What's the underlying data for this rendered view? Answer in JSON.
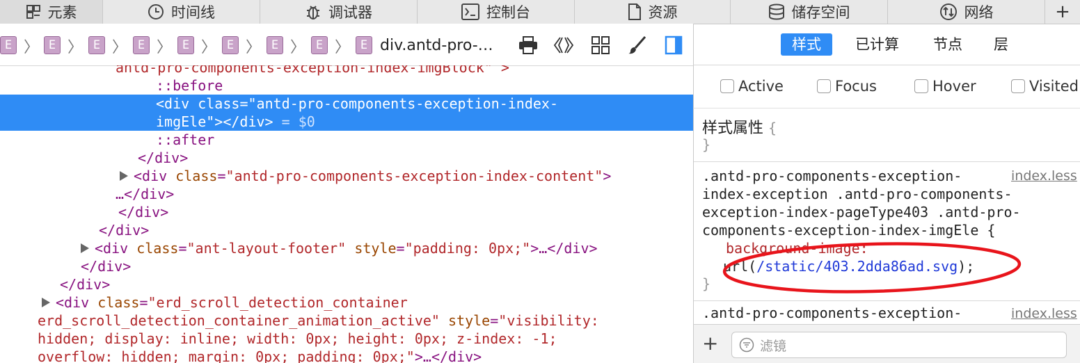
{
  "tabs": [
    {
      "label": "元素",
      "icon": "elements-grid-icon"
    },
    {
      "label": "时间线",
      "icon": "clock-icon"
    },
    {
      "label": "调试器",
      "icon": "bug-icon"
    },
    {
      "label": "控制台",
      "icon": "console-icon"
    },
    {
      "label": "资源",
      "icon": "document-icon"
    },
    {
      "label": "储存空间",
      "icon": "database-icon"
    },
    {
      "label": "网络",
      "icon": "network-arrows-icon"
    },
    {
      "label": "+",
      "icon": "plus-icon"
    }
  ],
  "breadcrumb": {
    "badge": "E",
    "separator": "〉",
    "last": "div.antd-pro-…"
  },
  "toolbar_icons": [
    "print-icon",
    "brackets-icon",
    "grid-icon",
    "brush-icon",
    "sidebar-toggle-icon"
  ],
  "side_tabs": [
    {
      "label": "样式",
      "active": true
    },
    {
      "label": "已计算",
      "active": false
    },
    {
      "label": "节点",
      "active": false
    },
    {
      "label": "层",
      "active": false
    }
  ],
  "pseudo_states": [
    "Active",
    "Focus",
    "Hover",
    "Visited"
  ],
  "tree": {
    "l0_text": "antd-pro-components-exception-index-imgBlock\" >",
    "before": "::before",
    "sel1_tag_open": "<div ",
    "sel1_attr": "class",
    "sel1_eq": "=",
    "sel1_val": "\"antd-pro-components-exception-index-",
    "sel2_val": "imgEle\"",
    "sel2_close": "></div>",
    "sel2_ref": " = $0",
    "after": "::after",
    "close_div": "</div>",
    "content_open": "<div ",
    "content_attr": "class",
    "content_val": "\"antd-pro-components-exception-index-content\"",
    "content_gt": ">",
    "ellipsis_close": "…</div>",
    "footer_attr1": "class",
    "footer_val1": "\"ant-layout-footer\"",
    "footer_attr2": "style",
    "footer_val2": "\"padding: 0px;\"",
    "footer_tail": ">…</div>",
    "erd_attr": "class",
    "erd_val1": "\"erd_scroll_detection_container",
    "erd_val2": "erd_scroll_detection_container_animation_active\"",
    "erd_style_attr": "style",
    "erd_style1": "\"visibility:",
    "erd_style2": "hidden; display: inline; width: 0px; height: 0px; z-index: -1;",
    "erd_style3": "overflow: hidden; margin: 0px; padding: 0px;\"",
    "erd_tail": ">…</div>"
  },
  "styles": {
    "inline_title": "样式属性",
    "open_brace": "{",
    "close_brace": "}",
    "rule1_selector": [
      ".antd-pro-components-exception-",
      "index-exception .antd-pro-components-",
      "exception-index-pageType403 .antd-pro-",
      "components-exception-index-imgEle {"
    ],
    "rule1_source": "index.less",
    "rule1_prop": "background-image:",
    "rule1_value_prefix": "url(",
    "rule1_value_url": "/static/403.2dda86ad.svg",
    "rule1_value_suffix": ");",
    "rule2_selector": ".antd-pro-components-exception-",
    "rule2_source": "index.less"
  },
  "filter": {
    "add_label": "+",
    "placeholder": "滤镜"
  },
  "colors": {
    "accent": "#2f8cf5",
    "highlight_ellipse": "#e8141b"
  }
}
